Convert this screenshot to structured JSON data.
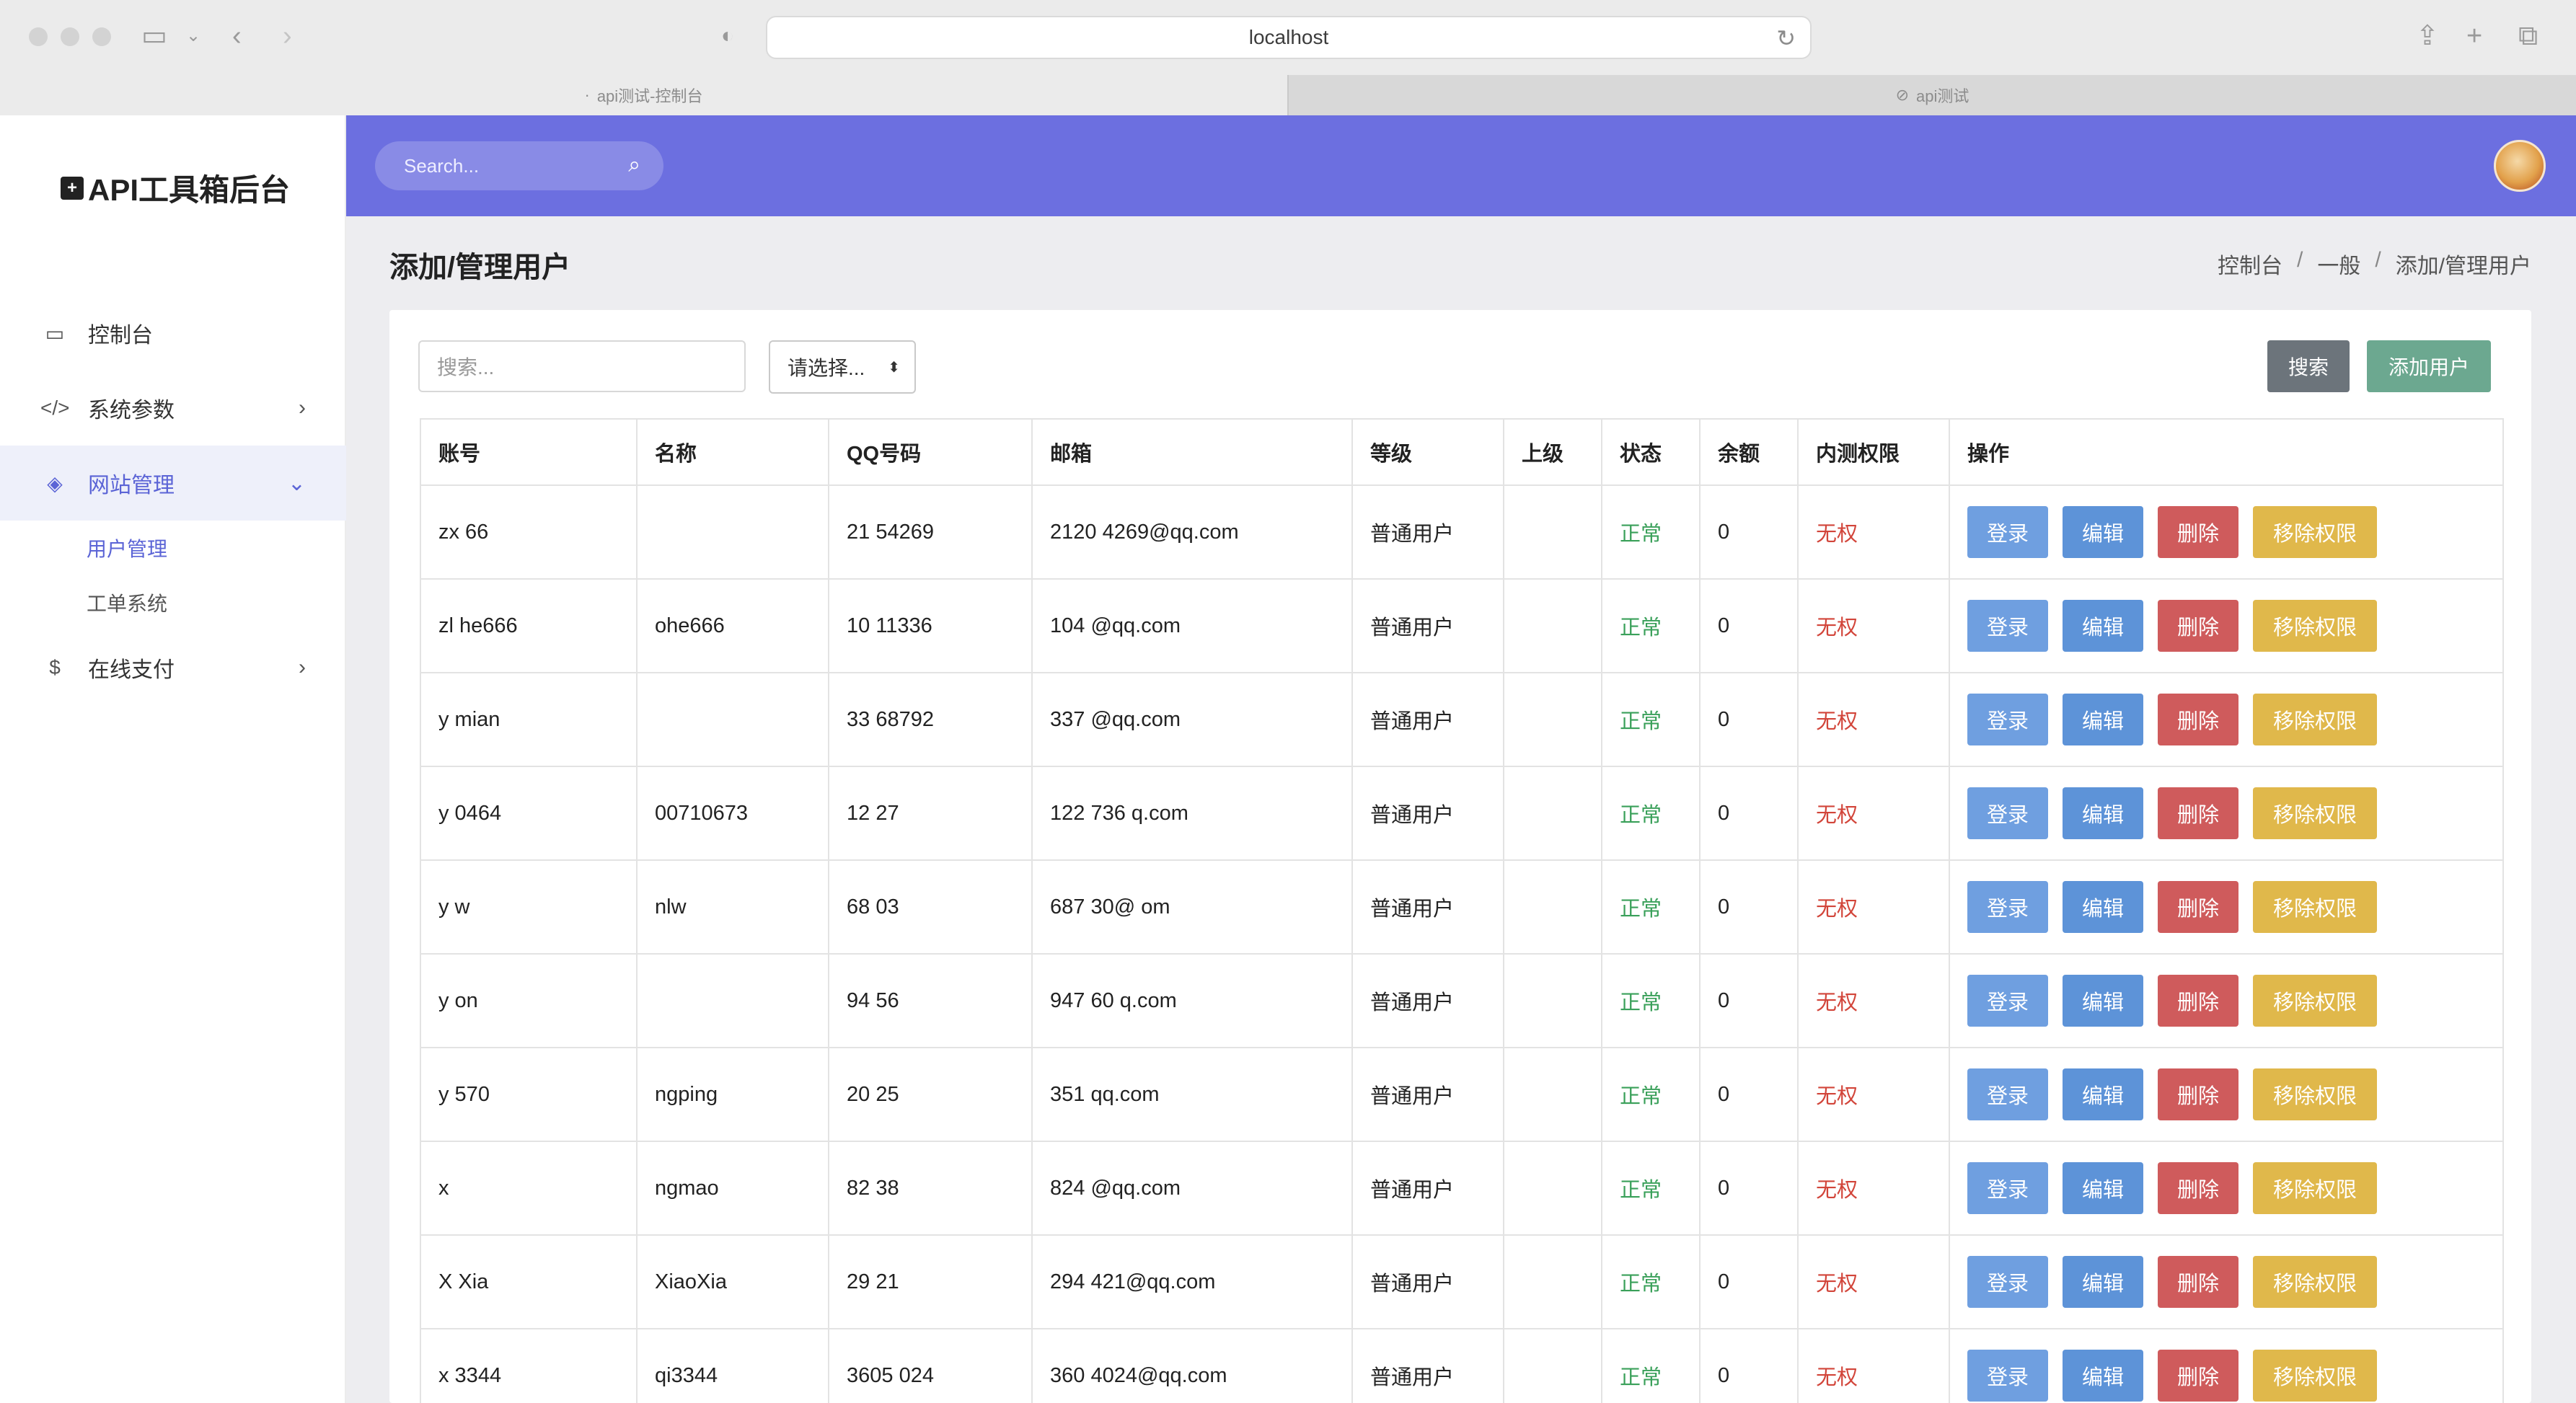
{
  "browser": {
    "url": "localhost",
    "tabs": [
      {
        "label": "api测试-控制台",
        "active": false
      },
      {
        "label": "api测试",
        "active": true
      }
    ]
  },
  "sidebar": {
    "logo": "API工具箱后台",
    "items": [
      {
        "label": "控制台",
        "icon": "monitor-icon"
      },
      {
        "label": "系统参数",
        "icon": "code-icon"
      },
      {
        "label": "网站管理",
        "icon": "web-icon"
      },
      {
        "label": "在线支付",
        "icon": "payment-icon"
      }
    ],
    "subitems": [
      {
        "label": "用户管理",
        "active": true
      },
      {
        "label": "工单系统",
        "active": false
      }
    ]
  },
  "header": {
    "search_placeholder": "Search..."
  },
  "page": {
    "title": "添加/管理用户",
    "breadcrumb": [
      "控制台",
      "一般",
      "添加/管理用户"
    ]
  },
  "toolbar": {
    "search_placeholder": "搜索...",
    "select_value": "请选择...",
    "search_button": "搜索",
    "add_button": "添加用户"
  },
  "table": {
    "headers": [
      "账号",
      "名称",
      "QQ号码",
      "邮箱",
      "等级",
      "上级",
      "状态",
      "余额",
      "内测权限",
      "操作"
    ],
    "action_labels": {
      "login": "登录",
      "edit": "编辑",
      "delete": "删除",
      "remove": "移除权限"
    },
    "rows": [
      {
        "account": "zx  66",
        "name": "",
        "qq": "21 54269",
        "email": "2120 4269@qq.com",
        "level": "普通用户",
        "parent": "",
        "status": "正常",
        "balance": "0",
        "perm": "无权"
      },
      {
        "account": "zl he666",
        "name": "ohe666",
        "qq": "10 11336",
        "email": "104 @qq.com",
        "level": "普通用户",
        "parent": "",
        "status": "正常",
        "balance": "0",
        "perm": "无权"
      },
      {
        "account": "y mian",
        "name": "",
        "qq": "33 68792",
        "email": "337 @qq.com",
        "level": "普通用户",
        "parent": "",
        "status": "正常",
        "balance": "0",
        "perm": "无权"
      },
      {
        "account": "y 0464",
        "name": "00710673",
        "qq": "12 27",
        "email": "122 736 q.com",
        "level": "普通用户",
        "parent": "",
        "status": "正常",
        "balance": "0",
        "perm": "无权"
      },
      {
        "account": "y w",
        "name": "nlw",
        "qq": "68 03",
        "email": "687 30@ om",
        "level": "普通用户",
        "parent": "",
        "status": "正常",
        "balance": "0",
        "perm": "无权"
      },
      {
        "account": "y on",
        "name": "",
        "qq": "94 56",
        "email": "947 60 q.com",
        "level": "普通用户",
        "parent": "",
        "status": "正常",
        "balance": "0",
        "perm": "无权"
      },
      {
        "account": "y 570",
        "name": "ngping",
        "qq": "20 25",
        "email": "351 qq.com",
        "level": "普通用户",
        "parent": "",
        "status": "正常",
        "balance": "0",
        "perm": "无权"
      },
      {
        "account": "x",
        "name": "ngmao",
        "qq": "82 38",
        "email": "824 @qq.com",
        "level": "普通用户",
        "parent": "",
        "status": "正常",
        "balance": "0",
        "perm": "无权"
      },
      {
        "account": "X Xia",
        "name": "XiaoXia",
        "qq": "29 21",
        "email": "294 421@qq.com",
        "level": "普通用户",
        "parent": "",
        "status": "正常",
        "balance": "0",
        "perm": "无权"
      },
      {
        "account": "x 3344",
        "name": "qi3344",
        "qq": "3605 024",
        "email": "360 4024@qq.com",
        "level": "普通用户",
        "parent": "",
        "status": "正常",
        "balance": "0",
        "perm": "无权"
      }
    ]
  },
  "colors": {
    "header_bg": "#6c6fe0",
    "accent": "#5b64d6",
    "status_ok": "#3aa05a",
    "status_none": "#d2453a",
    "btn_login": "#6f9fe0",
    "btn_edit": "#5d93d8",
    "btn_delete": "#cf5b5c",
    "btn_remove": "#e0b84b",
    "btn_search": "#6c747b",
    "btn_add": "#6ca890"
  }
}
